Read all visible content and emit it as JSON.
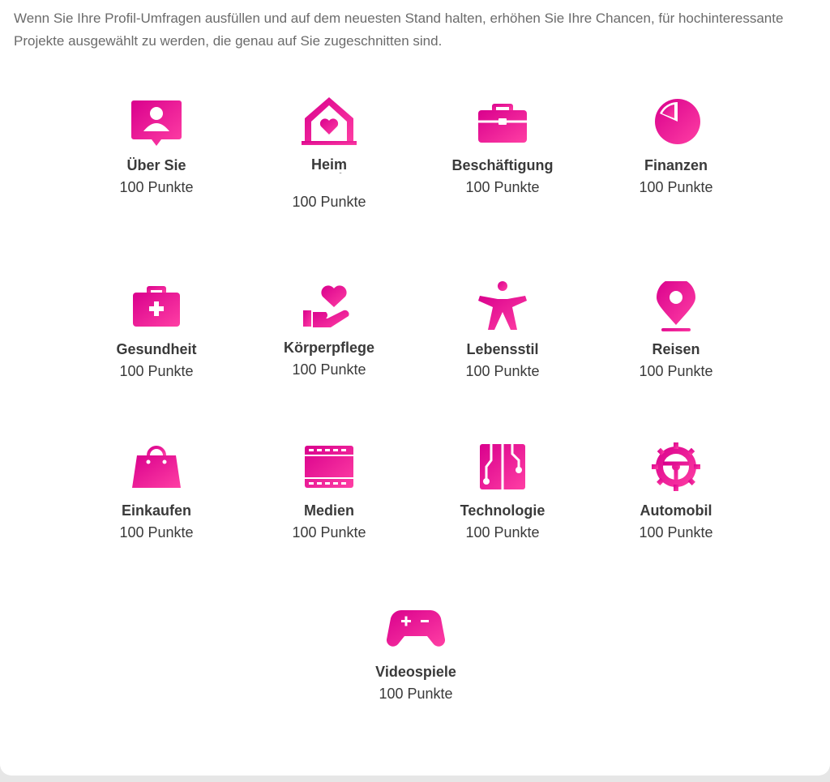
{
  "intro_text": "Wenn Sie Ihre Profil-Umfragen ausfüllen und auf dem neuesten Stand halten, erhöhen Sie Ihre Chancen, für hochinteressante Projekte ausgewählt zu werden, die genau auf Sie zugeschnitten sind.",
  "accent_colors": {
    "start": "#d9008d",
    "end": "#ff3fa4"
  },
  "categories": [
    {
      "title": "Über Sie",
      "points": "100 Punkte",
      "icon": "user-card-icon"
    },
    {
      "title": "Heim und Familie",
      "points": "100 Punkte",
      "icon": "house-heart-icon"
    },
    {
      "title": "Beschäftigung",
      "points": "100 Punkte",
      "icon": "briefcase-icon"
    },
    {
      "title": "Finanzen",
      "points": "100 Punkte",
      "icon": "pie-chart-icon"
    },
    {
      "title": "Gesundheit",
      "points": "100 Punkte",
      "icon": "medical-kit-icon"
    },
    {
      "title": "Körperpflege",
      "points": "100 Punkte",
      "icon": "hand-heart-icon"
    },
    {
      "title": "Lebensstil",
      "points": "100 Punkte",
      "icon": "person-icon"
    },
    {
      "title": "Reisen",
      "points": "100 Punkte",
      "icon": "map-pin-icon"
    },
    {
      "title": "Einkaufen",
      "points": "100 Punkte",
      "icon": "shopping-bag-icon"
    },
    {
      "title": "Medien",
      "points": "100 Punkte",
      "icon": "film-strip-icon"
    },
    {
      "title": "Technologie",
      "points": "100 Punkte",
      "icon": "circuit-board-icon"
    },
    {
      "title": "Automobil",
      "points": "100 Punkte",
      "icon": "steering-wheel-icon"
    },
    {
      "title": "Videospiele",
      "points": "100 Punkte",
      "icon": "gamepad-icon"
    }
  ]
}
